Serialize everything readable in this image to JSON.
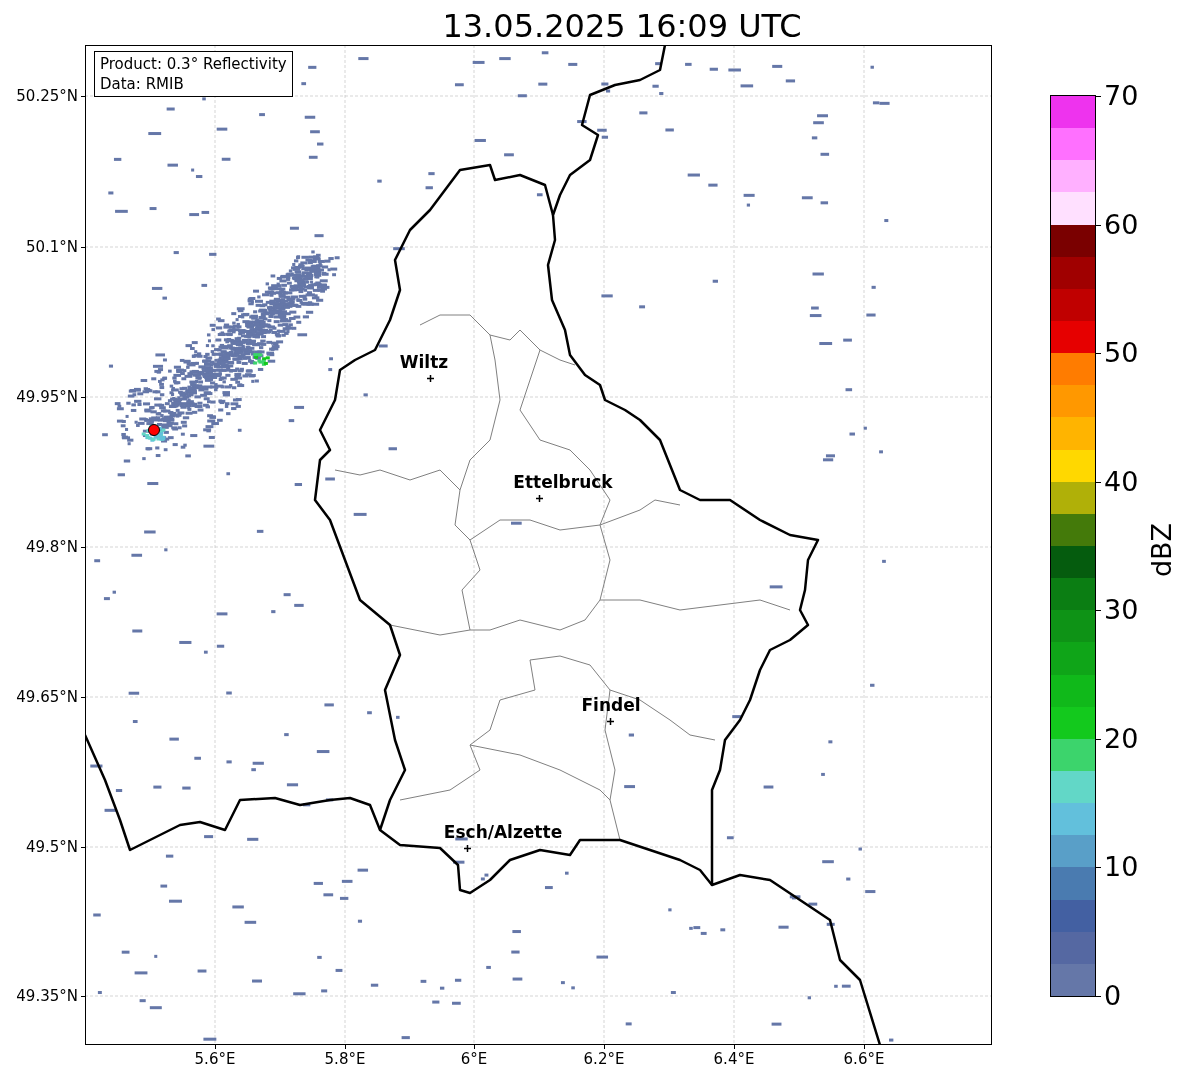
{
  "title": "13.05.2025 16:09 UTC",
  "info_box": [
    "Product: 0.3° Reflectivity",
    "Data: RMIB"
  ],
  "map": {
    "lat_ticks": [
      "50.25°N",
      "50.1°N",
      "49.95°N",
      "49.8°N",
      "49.65°N",
      "49.5°N",
      "49.35°N"
    ],
    "lon_ticks": [
      "5.6°E",
      "5.8°E",
      "6°E",
      "6.2°E",
      "6.4°E",
      "6.6°E"
    ],
    "places": [
      {
        "name": "Wiltz"
      },
      {
        "name": "Ettelbruck"
      },
      {
        "name": "Findel"
      },
      {
        "name": "Esch/Alzette"
      }
    ]
  },
  "colorbar": {
    "label": "dBZ",
    "ticks": [
      "70",
      "60",
      "50",
      "40",
      "30",
      "20",
      "10",
      "0"
    ],
    "bins": [
      {
        "color": "#ee33ee"
      },
      {
        "color": "#ff70ff"
      },
      {
        "color": "#ffb0ff"
      },
      {
        "color": "#ffe0ff"
      },
      {
        "color": "#7a0000"
      },
      {
        "color": "#a00000"
      },
      {
        "color": "#c00000"
      },
      {
        "color": "#e60000"
      },
      {
        "color": "#ff7c00"
      },
      {
        "color": "#ff9800"
      },
      {
        "color": "#ffb400"
      },
      {
        "color": "#ffd800"
      },
      {
        "color": "#b0b008"
      },
      {
        "color": "#447a0a"
      },
      {
        "color": "#055c0e"
      },
      {
        "color": "#0b7e13"
      },
      {
        "color": "#0e9316"
      },
      {
        "color": "#0fa518"
      },
      {
        "color": "#10b91a"
      },
      {
        "color": "#13c91d"
      },
      {
        "color": "#3cd46c"
      },
      {
        "color": "#62d7c7"
      },
      {
        "color": "#62c0dc"
      },
      {
        "color": "#599fc8"
      },
      {
        "color": "#4a7bb0"
      },
      {
        "color": "#4360a2"
      },
      {
        "color": "#5568a2"
      },
      {
        "color": "#6577a8"
      }
    ]
  }
}
